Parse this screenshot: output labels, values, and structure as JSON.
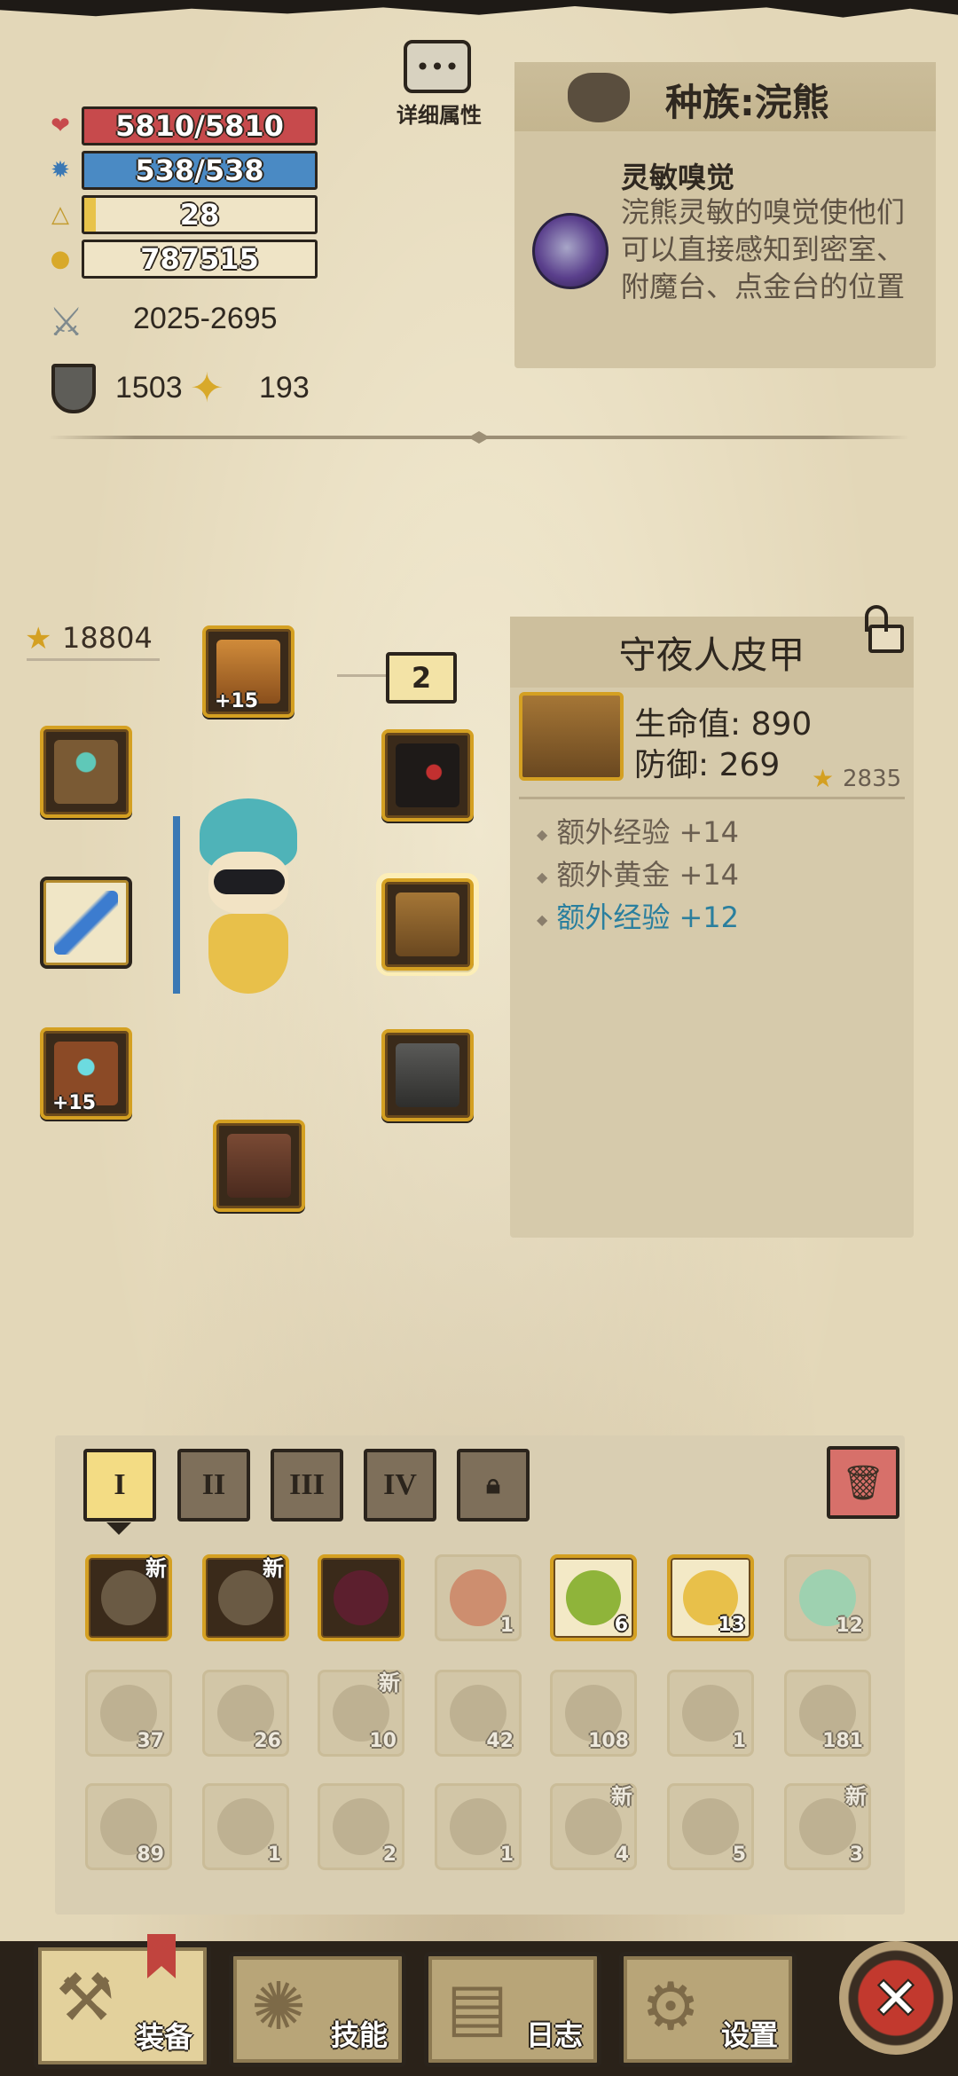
{
  "stats": {
    "hp": "5810/5810",
    "mp": "538/538",
    "level": "28",
    "gold": "787515",
    "attack": "2025-2695",
    "defense": "1503",
    "luck": "193",
    "hp_fill": 1.0,
    "mp_fill": 1.0,
    "level_fill": 0.05
  },
  "detail_button_label": "详细属性",
  "race": {
    "title": "种族:浣熊",
    "ability_name": "灵敏嗅觉",
    "ability_desc": "浣熊灵敏的嗅觉使他们可以直接感知到密室、附魔台、点金台的位置"
  },
  "equipment": {
    "score": "18804",
    "helmet_level": "+15",
    "ring_level": "+15",
    "accessory_count": "2"
  },
  "selected_item": {
    "name": "守夜人皮甲",
    "hp": "生命值: 890",
    "defense": "防御: 269",
    "score": "2835",
    "affixes": [
      {
        "text": "额外经验 +14",
        "highlight": false
      },
      {
        "text": "额外黄金 +14",
        "highlight": false
      },
      {
        "text": "额外经验 +12",
        "highlight": true
      }
    ]
  },
  "inventory": {
    "tabs": [
      "I",
      "II",
      "III",
      "IV"
    ],
    "new_label": "新",
    "row1": [
      {
        "count": "",
        "new": true
      },
      {
        "count": "",
        "new": true
      },
      {
        "count": "",
        "new": false
      },
      {
        "count": "1",
        "new": false
      },
      {
        "count": "6",
        "new": false
      },
      {
        "count": "13",
        "new": false
      },
      {
        "count": "12",
        "new": false
      }
    ],
    "row2": [
      "37",
      "26",
      "10",
      "42",
      "108",
      "1",
      "181"
    ],
    "row3": [
      "89",
      "1",
      "2",
      "1",
      "4",
      "5",
      "3"
    ]
  },
  "nav": {
    "equipment": "装备",
    "skills": "技能",
    "journal": "日志",
    "settings": "设置"
  },
  "colors": {
    "hp": "#c74a4c",
    "mp": "#4a8ac4",
    "level": "#e8c34a",
    "affix_highlight": "#2a7f9e"
  }
}
